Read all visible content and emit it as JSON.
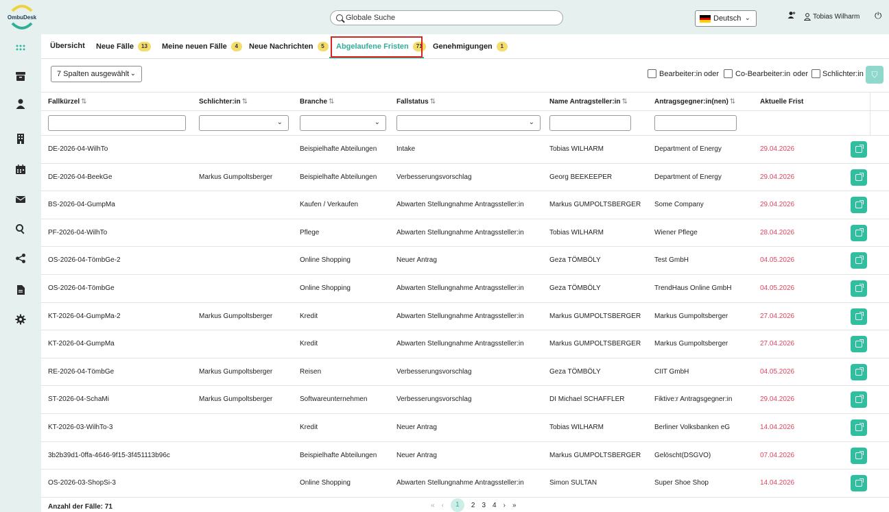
{
  "app": {
    "logo_text": "OmbuDesk"
  },
  "header": {
    "search_placeholder": "Globale Suche",
    "language": "Deutsch",
    "user_name": "Tobias Wilharm"
  },
  "tabs": [
    {
      "label": "Übersicht",
      "badge": ""
    },
    {
      "label": "Neue Fälle",
      "badge": "13"
    },
    {
      "label": "Meine neuen Fälle",
      "badge": "4"
    },
    {
      "label": "Neue Nachrichten",
      "badge": "5"
    },
    {
      "label": "Abgelaufene Fristen",
      "badge": "71"
    },
    {
      "label": "Genehmigungen",
      "badge": "1"
    }
  ],
  "toolbar": {
    "columns_selected": "7 Spalten ausgewählt",
    "filter_bearbeiter": "Bearbeiter:in",
    "or1": "oder",
    "filter_cobearbeiter": "Co-Bearbeiter:in",
    "or2": "oder",
    "filter_schlichter": "Schlichter:in"
  },
  "table": {
    "headers": [
      "Fallkürzel",
      "Schlichter:in",
      "Branche",
      "Fallstatus",
      "Name Antragsteller:in",
      "Antragsgegner:in(nen)",
      "Aktuelle Frist"
    ],
    "rows": [
      [
        "DE-2026-04-WilhTo",
        "",
        "Beispielhafte Abteilungen",
        "Intake",
        "Tobias WILHARM",
        "Department of Energy",
        "29.04.2026"
      ],
      [
        "DE-2026-04-BeekGe",
        "Markus Gumpoltsberger",
        "Beispielhafte Abteilungen",
        "Verbesserungsvorschlag",
        "Georg BEEKEEPER",
        "Department of Energy",
        "29.04.2026"
      ],
      [
        "BS-2026-04-GumpMa",
        "",
        "Kaufen / Verkaufen",
        "Abwarten Stellungnahme Antragssteller:in",
        "Markus GUMPOLTSBERGER",
        "Some Company",
        "29.04.2026"
      ],
      [
        "PF-2026-04-WilhTo",
        "",
        "Pflege",
        "Abwarten Stellungnahme Antragssteller:in",
        "Tobias WILHARM",
        "Wiener Pflege",
        "28.04.2026"
      ],
      [
        "OS-2026-04-TömbGe-2",
        "",
        "Online Shopping",
        "Neuer Antrag",
        "Geza TÖMBÖLY",
        "Test GmbH",
        "04.05.2026"
      ],
      [
        "OS-2026-04-TömbGe",
        "",
        "Online Shopping",
        "Abwarten Stellungnahme Antragssteller:in",
        "Geza TÖMBÖLY",
        "TrendHaus Online GmbH",
        "04.05.2026"
      ],
      [
        "KT-2026-04-GumpMa-2",
        "Markus Gumpoltsberger",
        "Kredit",
        "Abwarten Stellungnahme Antragssteller:in",
        "Markus GUMPOLTSBERGER",
        "Markus Gumpoltsberger",
        "27.04.2026"
      ],
      [
        "KT-2026-04-GumpMa",
        "",
        "Kredit",
        "Abwarten Stellungnahme Antragssteller:in",
        "Markus GUMPOLTSBERGER",
        "Markus Gumpoltsberger",
        "27.04.2026"
      ],
      [
        "RE-2026-04-TömbGe",
        "Markus Gumpoltsberger",
        "Reisen",
        "Verbesserungsvorschlag",
        "Geza TÖMBÖLY",
        "CIIT GmbH",
        "04.05.2026"
      ],
      [
        "ST-2026-04-SchaMi",
        "Markus Gumpoltsberger",
        "Softwareunternehmen",
        "Verbesserungsvorschlag",
        "DI Michael SCHAFFLER",
        "Fiktive:r Antragsgegner:in",
        "29.04.2026"
      ],
      [
        "KT-2026-03-WilhTo-3",
        "",
        "Kredit",
        "Neuer Antrag",
        "Tobias WILHARM",
        "Berliner Volksbanken eG",
        "14.04.2026"
      ],
      [
        "3b2b39d1-0ffa-4646-9f15-3f451113b96c",
        "",
        "Beispielhafte Abteilungen",
        "Neuer Antrag",
        "Markus GUMPOLTSBERGER",
        "Gelöscht(DSGVO)",
        "07.04.2026"
      ],
      [
        "OS-2026-03-ShopSi-3",
        "",
        "Online Shopping",
        "Abwarten Stellungnahme Antragssteller:in",
        "Simon SULTAN",
        "Super Shoe Shop",
        "14.04.2026"
      ]
    ]
  },
  "footer": {
    "count_label": "Anzahl der Fälle: 71",
    "pages": [
      "1",
      "2",
      "3",
      "4"
    ],
    "current_page": "1"
  },
  "colors": {
    "accent": "#2fae98",
    "due": "#e0455e",
    "badge": "#f5dd6b",
    "chrome": "#e6f1ef",
    "highlight": "#d9231d"
  }
}
